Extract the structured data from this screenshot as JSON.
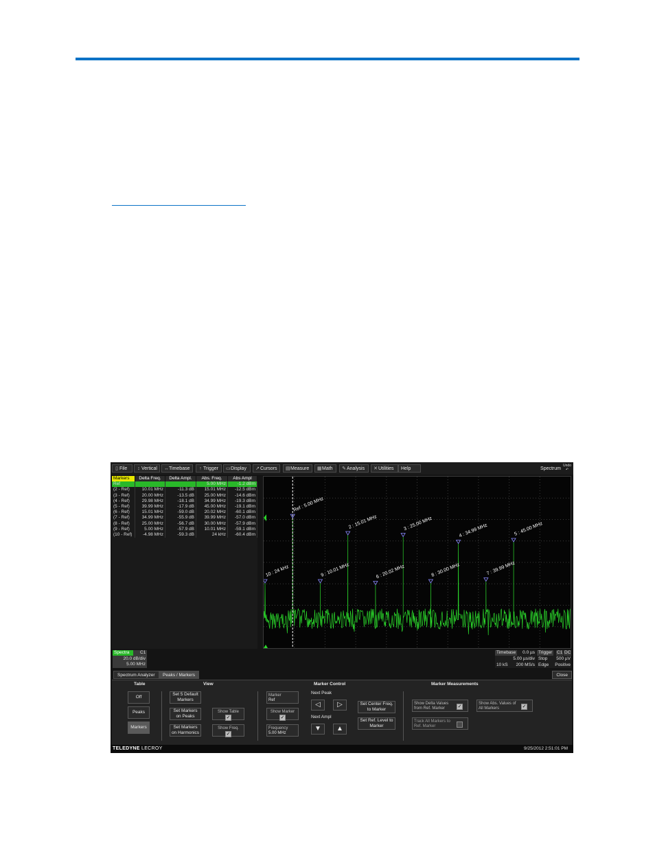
{
  "menu": [
    {
      "label": "File",
      "icon": "file-icon",
      "glyph": "▯"
    },
    {
      "label": "Vertical",
      "icon": "vertical-icon",
      "glyph": "↕"
    },
    {
      "label": "Timebase",
      "icon": "timebase-icon",
      "glyph": "↔"
    },
    {
      "label": "Trigger",
      "icon": "trigger-icon",
      "glyph": "↑"
    },
    {
      "label": "Display",
      "icon": "display-icon",
      "glyph": "▭"
    },
    {
      "label": "Cursors",
      "icon": "cursors-icon",
      "glyph": "↗"
    },
    {
      "label": "Measure",
      "icon": "measure-icon",
      "glyph": "▤"
    },
    {
      "label": "Math",
      "icon": "math-icon",
      "glyph": "▦"
    },
    {
      "label": "Analysis",
      "icon": "analysis-icon",
      "glyph": "✎"
    },
    {
      "label": "Utilities",
      "icon": "utilities-icon",
      "glyph": "✕"
    },
    {
      "label": "Help",
      "icon": "",
      "glyph": ""
    }
  ],
  "menu_right": {
    "mode": "Spectrum",
    "undo": "Undo"
  },
  "marker_table": {
    "headers": [
      "Markers",
      "Delta Freq.",
      "Delta Ampl.",
      "Abs. Freq.",
      "Abs Ampl"
    ],
    "rows": [
      [
        "Ref",
        "",
        "",
        "5.00 MHz",
        "-1.2 dBm"
      ],
      [
        "(2 - Ref)",
        "10.01 MHz",
        "-11.3 dB",
        "15.01 MHz",
        "-12.5 dBm"
      ],
      [
        "(3 - Ref)",
        "20.00 MHz",
        "-13.5 dB",
        "25.00 MHz",
        "-14.6 dBm"
      ],
      [
        "(4 - Ref)",
        "29.98 MHz",
        "-18.1 dB",
        "34.99 MHz",
        "-19.3 dBm"
      ],
      [
        "(5 - Ref)",
        "39.99 MHz",
        "-17.9 dB",
        "45.00 MHz",
        "-19.1 dBm"
      ],
      [
        "(6 - Ref)",
        "15.01 MHz",
        "-59.0 dB",
        "20.02 MHz",
        "-60.1 dBm"
      ],
      [
        "(7 - Ref)",
        "34.99 MHz",
        "-55.9 dB",
        "39.99 MHz",
        "-57.0 dBm"
      ],
      [
        "(8 - Ref)",
        "25.00 MHz",
        "-56.7 dB",
        "30.00 MHz",
        "-57.9 dBm"
      ],
      [
        "(9 - Ref)",
        "5.00 MHz",
        "-57.9 dB",
        "10.01 MHz",
        "-59.1 dBm"
      ],
      [
        "(10 - Ref)",
        "-4.98 MHz",
        "-59.3 dB",
        "24 kHz",
        "-60.4 dBm"
      ]
    ]
  },
  "graph": {
    "trace_color": "#2bd62b",
    "markers": [
      {
        "label": "Ref : 5.00 MHz",
        "x": 0.1,
        "level": 0.76
      },
      {
        "label": "2 : 15.01 MHz",
        "x": 0.3,
        "level": 0.66
      },
      {
        "label": "3 : 25.00 MHz",
        "x": 0.5,
        "level": 0.65
      },
      {
        "label": "4 : 34.99 MHz",
        "x": 0.7,
        "level": 0.61
      },
      {
        "label": "5 : 45.00 MHz",
        "x": 0.9,
        "level": 0.62
      },
      {
        "label": "10 : 24 kHz",
        "x": 0.0,
        "level": 0.38
      },
      {
        "label": "9 : 10.01 MHz",
        "x": 0.2,
        "level": 0.38
      },
      {
        "label": "6 : 20.02 MHz",
        "x": 0.4,
        "level": 0.37
      },
      {
        "label": "8 : 30.00 MHz",
        "x": 0.6,
        "level": 0.38
      },
      {
        "label": "7 : 39.99 MHz",
        "x": 0.8,
        "level": 0.39
      }
    ]
  },
  "trace_info": {
    "name": "Spectra",
    "source": "C1",
    "scale": "20.0 dB/div",
    "center": "5.00 MHz"
  },
  "timebase": {
    "label": "Timebase",
    "delay": "0.0 µs",
    "per_div": "5.00 µs/div",
    "samples": "10 kS",
    "rate": "200 MS/s"
  },
  "trigger": {
    "label": "Trigger",
    "ch": "C1",
    "coupling": "DC",
    "mode": "Stop",
    "level": "500 µV",
    "type": "Edge",
    "slope": "Positive"
  },
  "tabs": {
    "spectrum": "Spectrum Analyzer",
    "peaks": "Peaks / Markers",
    "close": "Close"
  },
  "panel": {
    "table_title": "Table",
    "table_off": "Off",
    "table_peaks": "Peaks",
    "table_markers": "Markers",
    "view_title": "View",
    "set_default": "Set 5 Default Markers",
    "set_peaks": "Set Markers on Peaks",
    "set_harmonics": "Set Markers on Harmonics",
    "show_table": "Show Table",
    "show_freq": "Show Freq.",
    "marker_control_title": "Marker Control",
    "marker_label": "Marker",
    "marker_value": "Ref",
    "show_marker": "Show Marker",
    "frequency_label": "Frequency",
    "frequency_value": "5.00 MHz",
    "next_peak": "Next Peak",
    "next_ampl": "Next Ampl",
    "set_center": "Set Center Freq. to Marker",
    "set_ref_level": "Set Ref. Level to Marker",
    "measurements_title": "Marker Measurements",
    "show_delta": "Show Delta Values from Ref. Marker",
    "show_abs": "Show Abs. Values of All Markers",
    "track_all": "Track All Markers to Ref. Marker"
  },
  "footer": {
    "brand_bold": "TELEDYNE",
    "brand_light": "LECROY",
    "datetime": "9/25/2012 2:51:01 PM"
  }
}
